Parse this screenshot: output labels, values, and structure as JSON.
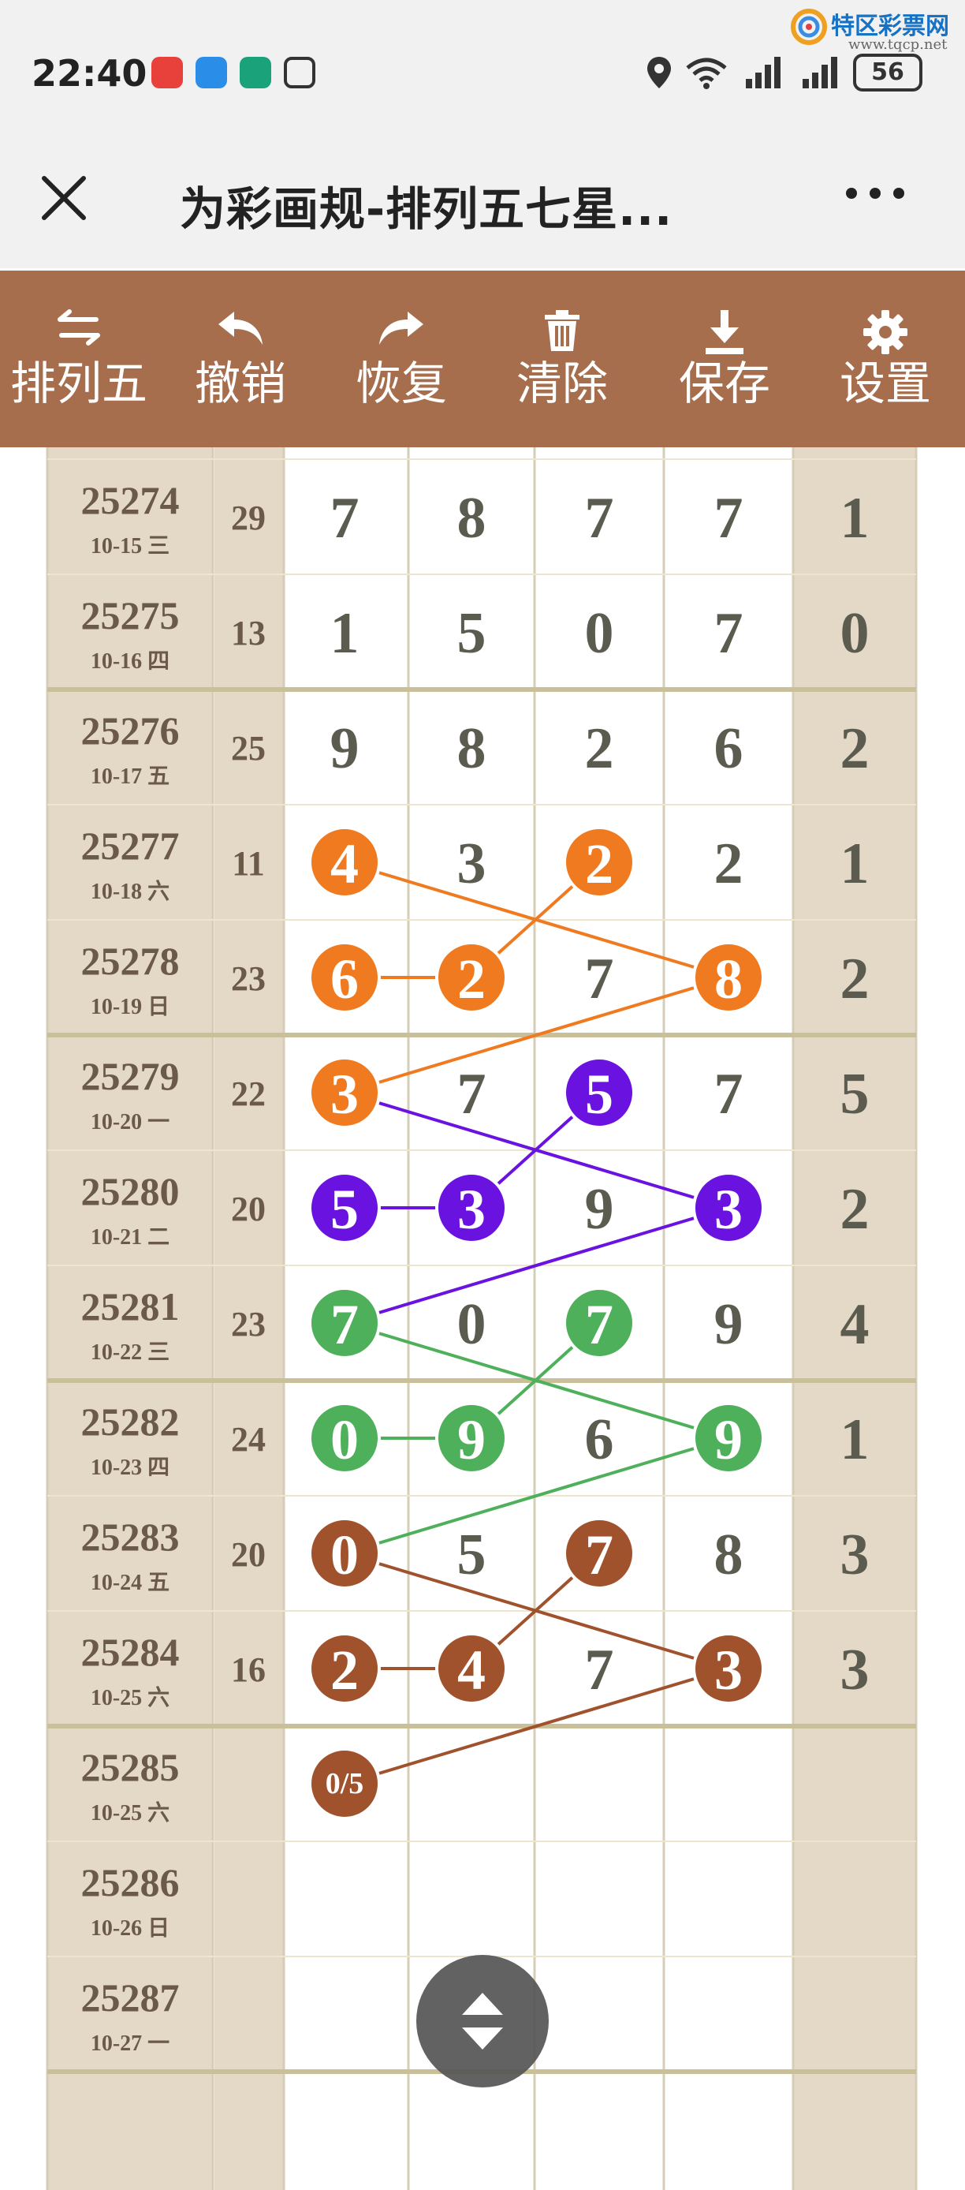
{
  "status_bar": {
    "time": "22:40",
    "battery": "56",
    "watermark_title": "特区彩票网",
    "watermark_url": "www.tqcp.net"
  },
  "app_bar": {
    "close_icon": "close-icon",
    "title": "为彩画规-排列五七星...",
    "more_icon": "more-icon"
  },
  "toolbar": {
    "items": [
      {
        "label": "排列五",
        "icon": "swap-icon"
      },
      {
        "label": "撤销",
        "icon": "undo-icon"
      },
      {
        "label": "恢复",
        "icon": "redo-icon"
      },
      {
        "label": "清除",
        "icon": "trash-icon"
      },
      {
        "label": "保存",
        "icon": "download-icon"
      },
      {
        "label": "设置",
        "icon": "gear-icon"
      }
    ]
  },
  "table": {
    "rows": [
      {
        "issue": "25274",
        "date": "10-15 三",
        "sum": "29",
        "digits": [
          "7",
          "8",
          "7",
          "7"
        ],
        "last": "1"
      },
      {
        "issue": "25275",
        "date": "10-16 四",
        "sum": "13",
        "digits": [
          "1",
          "5",
          "0",
          "7"
        ],
        "last": "0"
      },
      {
        "issue": "25276",
        "date": "10-17 五",
        "sum": "25",
        "digits": [
          "9",
          "8",
          "2",
          "6"
        ],
        "last": "2"
      },
      {
        "issue": "25277",
        "date": "10-18 六",
        "sum": "11",
        "digits": [
          "4",
          "3",
          "2",
          "2"
        ],
        "last": "1"
      },
      {
        "issue": "25278",
        "date": "10-19 日",
        "sum": "23",
        "digits": [
          "6",
          "2",
          "7",
          "8"
        ],
        "last": "2"
      },
      {
        "issue": "25279",
        "date": "10-20 一",
        "sum": "22",
        "digits": [
          "3",
          "7",
          "5",
          "7"
        ],
        "last": "5"
      },
      {
        "issue": "25280",
        "date": "10-21 二",
        "sum": "20",
        "digits": [
          "5",
          "3",
          "9",
          "3"
        ],
        "last": "2"
      },
      {
        "issue": "25281",
        "date": "10-22 三",
        "sum": "23",
        "digits": [
          "7",
          "0",
          "7",
          "9"
        ],
        "last": "4"
      },
      {
        "issue": "25282",
        "date": "10-23 四",
        "sum": "24",
        "digits": [
          "0",
          "9",
          "6",
          "9"
        ],
        "last": "1"
      },
      {
        "issue": "25283",
        "date": "10-24 五",
        "sum": "20",
        "digits": [
          "0",
          "5",
          "7",
          "8"
        ],
        "last": "3"
      },
      {
        "issue": "25284",
        "date": "10-25 六",
        "sum": "16",
        "digits": [
          "2",
          "4",
          "7",
          "3"
        ],
        "last": "3"
      },
      {
        "issue": "25285",
        "date": "10-25 六",
        "sum": "",
        "digits": [
          "0/5",
          "",
          "",
          ""
        ],
        "last": ""
      },
      {
        "issue": "25286",
        "date": "10-26 日",
        "sum": "",
        "digits": [
          "",
          "",
          "",
          ""
        ],
        "last": ""
      },
      {
        "issue": "25287",
        "date": "10-27 一",
        "sum": "",
        "digits": [
          "",
          "",
          "",
          ""
        ],
        "last": ""
      }
    ],
    "marks": [
      {
        "row": 3,
        "col": 0,
        "color": "orange"
      },
      {
        "row": 3,
        "col": 2,
        "color": "orange"
      },
      {
        "row": 4,
        "col": 0,
        "color": "orange"
      },
      {
        "row": 4,
        "col": 1,
        "color": "orange"
      },
      {
        "row": 4,
        "col": 3,
        "color": "orange"
      },
      {
        "row": 5,
        "col": 0,
        "color": "orange"
      },
      {
        "row": 5,
        "col": 2,
        "color": "purple"
      },
      {
        "row": 6,
        "col": 0,
        "color": "purple"
      },
      {
        "row": 6,
        "col": 1,
        "color": "purple"
      },
      {
        "row": 6,
        "col": 3,
        "color": "purple"
      },
      {
        "row": 7,
        "col": 0,
        "color": "green"
      },
      {
        "row": 7,
        "col": 2,
        "color": "green"
      },
      {
        "row": 8,
        "col": 0,
        "color": "green"
      },
      {
        "row": 8,
        "col": 1,
        "color": "green"
      },
      {
        "row": 8,
        "col": 3,
        "color": "green"
      },
      {
        "row": 9,
        "col": 0,
        "color": "brown"
      },
      {
        "row": 9,
        "col": 2,
        "color": "brown"
      },
      {
        "row": 10,
        "col": 0,
        "color": "brown"
      },
      {
        "row": 10,
        "col": 1,
        "color": "brown"
      },
      {
        "row": 10,
        "col": 3,
        "color": "brown"
      },
      {
        "row": 11,
        "col": 0,
        "color": "brown"
      }
    ],
    "links": [
      {
        "from": [
          3,
          0
        ],
        "to": [
          4,
          3
        ],
        "color": "orange"
      },
      {
        "from": [
          3,
          2
        ],
        "to": [
          4,
          1
        ],
        "color": "orange"
      },
      {
        "from": [
          4,
          0
        ],
        "to": [
          4,
          1
        ],
        "color": "orange"
      },
      {
        "from": [
          4,
          3
        ],
        "to": [
          5,
          0
        ],
        "color": "orange"
      },
      {
        "from": [
          5,
          0
        ],
        "to": [
          6,
          3
        ],
        "color": "purple"
      },
      {
        "from": [
          5,
          2
        ],
        "to": [
          6,
          1
        ],
        "color": "purple"
      },
      {
        "from": [
          6,
          0
        ],
        "to": [
          6,
          1
        ],
        "color": "purple"
      },
      {
        "from": [
          6,
          3
        ],
        "to": [
          7,
          0
        ],
        "color": "purple"
      },
      {
        "from": [
          7,
          0
        ],
        "to": [
          8,
          3
        ],
        "color": "green"
      },
      {
        "from": [
          7,
          2
        ],
        "to": [
          8,
          1
        ],
        "color": "green"
      },
      {
        "from": [
          8,
          0
        ],
        "to": [
          8,
          1
        ],
        "color": "green"
      },
      {
        "from": [
          8,
          3
        ],
        "to": [
          9,
          0
        ],
        "color": "green"
      },
      {
        "from": [
          9,
          0
        ],
        "to": [
          10,
          3
        ],
        "color": "brown"
      },
      {
        "from": [
          9,
          2
        ],
        "to": [
          10,
          1
        ],
        "color": "brown"
      },
      {
        "from": [
          10,
          0
        ],
        "to": [
          10,
          1
        ],
        "color": "brown"
      },
      {
        "from": [
          10,
          3
        ],
        "to": [
          11,
          0
        ],
        "color": "brown"
      }
    ]
  },
  "colors": {
    "toolbar_bg": "#a66e4c",
    "orange": "#f07a1f",
    "purple": "#6a12e0",
    "green": "#4eb05a",
    "brown": "#a0522d",
    "column_bg": "#e4d8c7"
  },
  "fab": {
    "icon": "scroll-up-down-icon"
  }
}
